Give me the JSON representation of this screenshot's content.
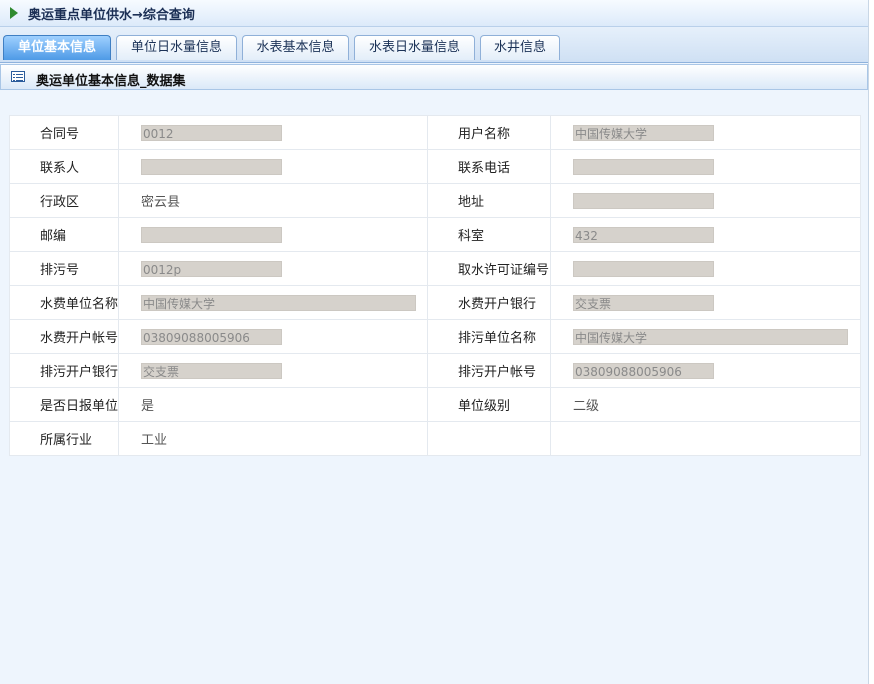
{
  "header": {
    "title": "奥运重点单位供水→综合查询"
  },
  "tabs": [
    {
      "label": "单位基本信息"
    },
    {
      "label": "单位日水量信息"
    },
    {
      "label": "水表基本信息"
    },
    {
      "label": "水表日水量信息"
    },
    {
      "label": "水井信息"
    }
  ],
  "section": {
    "title": "奥运单位基本信息_数据集"
  },
  "fields": {
    "contract_no": {
      "label": "合同号",
      "value": "0012"
    },
    "user_name": {
      "label": "用户名称",
      "value": "中国传媒大学"
    },
    "contact": {
      "label": "联系人",
      "value": ""
    },
    "phone": {
      "label": "联系电话",
      "value": ""
    },
    "district": {
      "label": "行政区",
      "value": "密云县"
    },
    "address": {
      "label": "地址",
      "value": ""
    },
    "postcode": {
      "label": "邮编",
      "value": ""
    },
    "dept": {
      "label": "科室",
      "value": "432"
    },
    "sewage_no": {
      "label": "排污号",
      "value": "0012p"
    },
    "water_permit": {
      "label": "取水许可证编号",
      "value": ""
    },
    "fee_unit": {
      "label": "水费单位名称",
      "value": "中国传媒大学"
    },
    "fee_bank": {
      "label": "水费开户银行",
      "value": "交支票"
    },
    "fee_account": {
      "label": "水费开户帐号",
      "value": "03809088005906"
    },
    "sewage_unit": {
      "label": "排污单位名称",
      "value": "中国传媒大学"
    },
    "sewage_bank": {
      "label": "排污开户银行",
      "value": "交支票"
    },
    "sewage_account": {
      "label": "排污开户帐号",
      "value": "03809088005906"
    },
    "daily_report": {
      "label": "是否日报单位",
      "value": "是"
    },
    "level": {
      "label": "单位级别",
      "value": "二级"
    },
    "industry": {
      "label": "所属行业",
      "value": "工业"
    }
  },
  "colors": {
    "accent": "#4e9ae6",
    "input_bg": "#d6d2cc",
    "page_bg": "#eef5fd"
  }
}
